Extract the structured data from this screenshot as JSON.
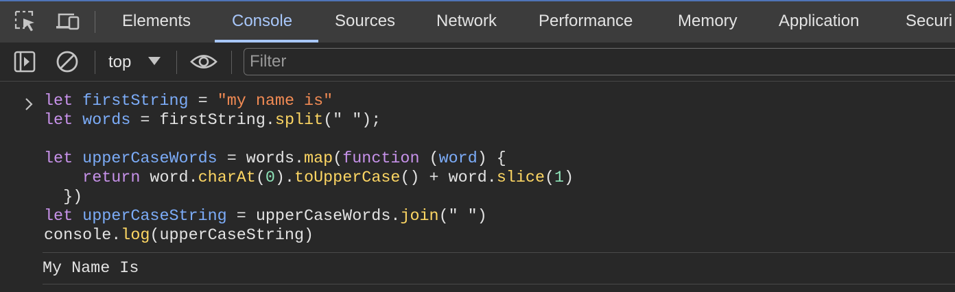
{
  "tabs": [
    {
      "label": "Elements"
    },
    {
      "label": "Console"
    },
    {
      "label": "Sources"
    },
    {
      "label": "Network"
    },
    {
      "label": "Performance"
    },
    {
      "label": "Memory"
    },
    {
      "label": "Application"
    },
    {
      "label": "Securi"
    }
  ],
  "active_tab": "Console",
  "toolbar": {
    "context_label": "top",
    "filter_placeholder": "Filter"
  },
  "icons": {
    "inspect": "inspect-element-icon",
    "device": "device-toolbar-icon",
    "sidebar": "sidebar-toggle-icon",
    "clear": "clear-console-icon",
    "dropdown": "chevron-down-icon",
    "live_expression": "eye-icon",
    "prompt": "chevron-right-icon"
  },
  "colors": {
    "accent": "#a8c7fa",
    "keyword": "#c792ea",
    "variable": "#7cacf8",
    "string": "#f28b54",
    "function": "#fdd663",
    "number": "#8ee3b8"
  },
  "console": {
    "input_lines": [
      {
        "tokens": [
          {
            "t": "let",
            "c": "kw"
          },
          {
            "t": " "
          },
          {
            "t": "firstString",
            "c": "var"
          },
          {
            "t": " = "
          },
          {
            "t": "\"my name is\"",
            "c": "str"
          }
        ]
      },
      {
        "tokens": [
          {
            "t": "let",
            "c": "kw"
          },
          {
            "t": " "
          },
          {
            "t": "words",
            "c": "var"
          },
          {
            "t": " = firstString."
          },
          {
            "t": "split",
            "c": "fn"
          },
          {
            "t": "(\" \");"
          }
        ]
      },
      {
        "tokens": []
      },
      {
        "tokens": [
          {
            "t": "let",
            "c": "kw"
          },
          {
            "t": " "
          },
          {
            "t": "upperCaseWords",
            "c": "var"
          },
          {
            "t": " = words."
          },
          {
            "t": "map",
            "c": "fn"
          },
          {
            "t": "("
          },
          {
            "t": "function",
            "c": "kw"
          },
          {
            "t": " ("
          },
          {
            "t": "word",
            "c": "var"
          },
          {
            "t": ") {"
          }
        ]
      },
      {
        "tokens": [
          {
            "t": "    "
          },
          {
            "t": "return",
            "c": "kw"
          },
          {
            "t": " word."
          },
          {
            "t": "charAt",
            "c": "fn"
          },
          {
            "t": "("
          },
          {
            "t": "0",
            "c": "num"
          },
          {
            "t": ")."
          },
          {
            "t": "toUpperCase",
            "c": "fn"
          },
          {
            "t": "() + word."
          },
          {
            "t": "slice",
            "c": "fn"
          },
          {
            "t": "("
          },
          {
            "t": "1",
            "c": "num"
          },
          {
            "t": ")"
          }
        ]
      },
      {
        "tokens": [
          {
            "t": "  })"
          }
        ]
      },
      {
        "tokens": [
          {
            "t": "let",
            "c": "kw"
          },
          {
            "t": " "
          },
          {
            "t": "upperCaseString",
            "c": "var"
          },
          {
            "t": " = upperCaseWords."
          },
          {
            "t": "join",
            "c": "fn"
          },
          {
            "t": "(\" \")"
          }
        ]
      },
      {
        "tokens": [
          {
            "t": "console."
          },
          {
            "t": "log",
            "c": "fn"
          },
          {
            "t": "(upperCaseString)"
          }
        ]
      }
    ],
    "output": "My Name Is"
  }
}
